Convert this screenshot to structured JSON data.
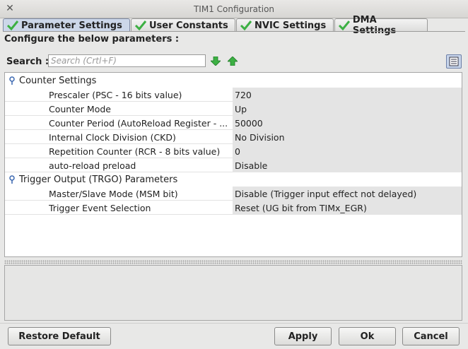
{
  "window": {
    "title": "TIM1 Configuration"
  },
  "tabs": [
    {
      "label": "Parameter Settings",
      "active": true
    },
    {
      "label": "User Constants",
      "active": false
    },
    {
      "label": "NVIC Settings",
      "active": false
    },
    {
      "label": "DMA Settings",
      "active": false
    }
  ],
  "heading": "Configure the below parameters :",
  "search": {
    "label": "Search :",
    "placeholder": "Search (Crtl+F)"
  },
  "groups": [
    {
      "name": "Counter Settings",
      "params": [
        {
          "label": "Prescaler (PSC - 16 bits value)",
          "value": "720"
        },
        {
          "label": "Counter Mode",
          "value": "Up"
        },
        {
          "label": "Counter Period (AutoReload Register - ...",
          "value": "50000"
        },
        {
          "label": "Internal Clock Division (CKD)",
          "value": "No Division"
        },
        {
          "label": "Repetition Counter (RCR - 8 bits value)",
          "value": "0"
        },
        {
          "label": "auto-reload preload",
          "value": "Disable"
        }
      ]
    },
    {
      "name": "Trigger Output (TRGO) Parameters",
      "params": [
        {
          "label": "Master/Slave Mode (MSM bit)",
          "value": "Disable (Trigger input effect not delayed)"
        },
        {
          "label": "Trigger Event Selection",
          "value": "Reset (UG bit from TIMx_EGR)"
        }
      ]
    }
  ],
  "buttons": {
    "restore": "Restore Default",
    "apply": "Apply",
    "ok": "Ok",
    "cancel": "Cancel"
  },
  "colors": {
    "check": "#3cb043",
    "arrow": "#3cb043",
    "active_tab": "#ccd7e9",
    "value_bg": "#e4e4e4"
  }
}
